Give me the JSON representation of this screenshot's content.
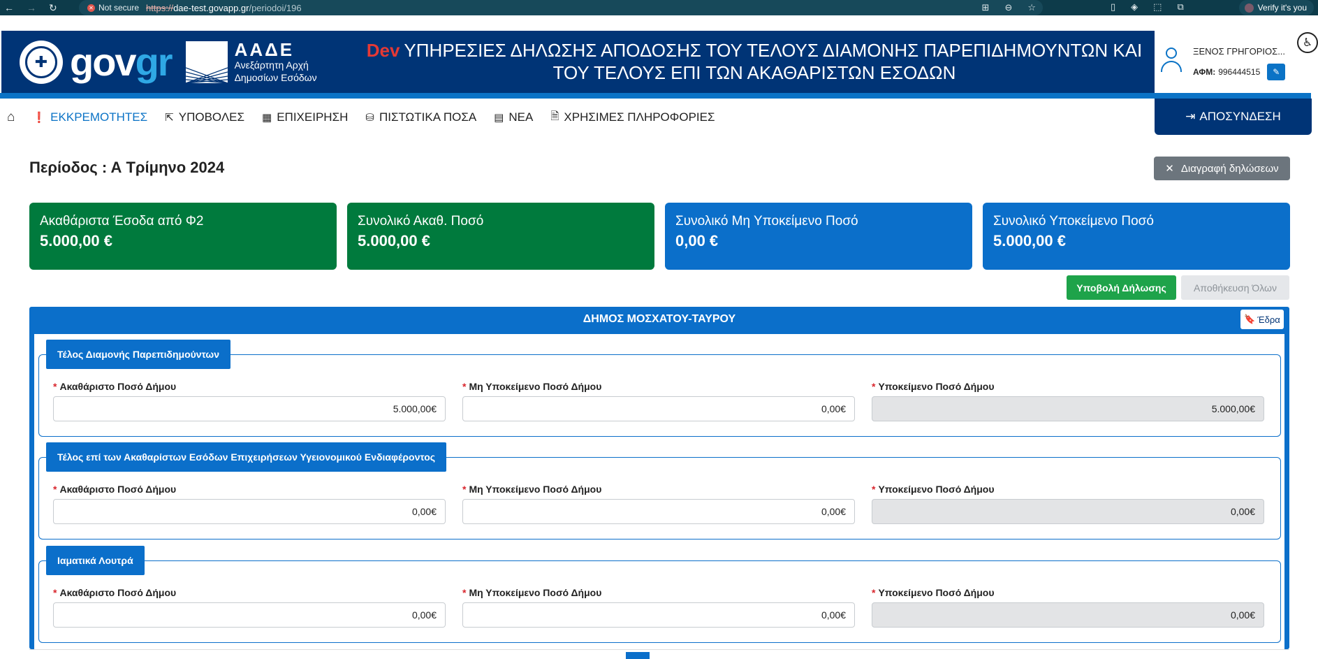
{
  "browser": {
    "security_label": "Not secure",
    "url_proto": "https://",
    "url_host": "dae-test.govapp.gr",
    "url_path": "/periodoi/196",
    "verify_label": "Verify it's you"
  },
  "header": {
    "logo_text_gov": "gov",
    "logo_text_gr": "gr",
    "aade_title": "ΑΑΔΕ",
    "aade_sub_1": "Ανεξάρτητη Αρχή",
    "aade_sub_2": "Δημοσίων Εσόδων",
    "env_label": "Dev",
    "title": "ΥΠΗΡΕΣΙΕΣ ΔΗΛΩΣΗΣ ΑΠΟΔΟΣΗΣ ΤΟΥ ΤΕΛΟΥΣ ΔΙΑΜΟΝΗΣ ΠΑΡΕΠΙΔΗΜΟΥΝΤΩΝ ΚΑΙ ΤΟΥ ΤΕΛΟΥΣ ΕΠΙ ΤΩΝ ΑΚΑΘΑΡΙΣΤΩΝ ΕΣΟΔΩΝ"
  },
  "user": {
    "name": "ΞΕΝΟΣ ΓΡΗΓΟΡΙΟΣ...",
    "afm_label": "ΑΦΜ:",
    "afm_value": "996444515"
  },
  "nav": {
    "items": [
      {
        "label": "ΕΚΚΡΕΜΟΤΗΤΕΣ"
      },
      {
        "label": "ΥΠΟΒΟΛΕΣ"
      },
      {
        "label": "ΕΠΙΧΕΙΡΗΣΗ"
      },
      {
        "label": "ΠΙΣΤΩΤΙΚΑ ΠΟΣΑ"
      },
      {
        "label": "ΝΕΑ"
      },
      {
        "label": "ΧΡΗΣΙΜΕΣ ΠΛΗΡΟΦΟΡΙΕΣ"
      }
    ],
    "logout_label": "ΑΠΟΣΥΝΔΕΣΗ"
  },
  "period": {
    "title": "Περίοδος : Α Τρίμηνο 2024",
    "delete_label": "Διαγραφή δηλώσεων"
  },
  "cards": [
    {
      "label": "Ακαθάριστα Έσοδα από Φ2",
      "value": "5.000,00 €",
      "color": "#007a3d"
    },
    {
      "label": "Συνολικό Ακαθ. Ποσό",
      "value": "5.000,00 €",
      "color": "#007a3d"
    },
    {
      "label": "Συνολικό Μη Υποκείμενο Ποσό",
      "value": "0,00 €",
      "color": "#0b6fca"
    },
    {
      "label": "Συνολικό Υποκείμενο Ποσό",
      "value": "5.000,00 €",
      "color": "#0b6fca"
    }
  ],
  "actions": {
    "submit_label": "Υποβολή Δήλωσης",
    "saveall_label": "Αποθήκευση Όλων"
  },
  "municipality": {
    "name": "ΔΗΜΟΣ ΜΟΣΧΑΤΟΥ-ΤΑΥΡΟΥ",
    "edra_label": "Έδρα",
    "sections": [
      {
        "title": "Τέλος Διαμονής Παρεπιδημούντων",
        "gross_label": "Ακαθάριστο Ποσό Δήμου",
        "gross_value": "5.000,00€",
        "nonsubject_label": "Μη Υποκείμενο Ποσό Δήμου",
        "nonsubject_value": "0,00€",
        "subject_label": "Υποκείμενο Ποσό Δήμου",
        "subject_value": "5.000,00€"
      },
      {
        "title": "Τέλος επί των Ακαθαρίστων Εσόδων Επιχειρήσεων Υγειονομικού Ενδιαφέροντος",
        "gross_label": "Ακαθάριστο Ποσό Δήμου",
        "gross_value": "0,00€",
        "nonsubject_label": "Μη Υποκείμενο Ποσό Δήμου",
        "nonsubject_value": "0,00€",
        "subject_label": "Υποκείμενο Ποσό Δήμου",
        "subject_value": "0,00€"
      },
      {
        "title": "Ιαματικά Λουτρά",
        "gross_label": "Ακαθάριστο Ποσό Δήμου",
        "gross_value": "0,00€",
        "nonsubject_label": "Μη Υποκείμενο Ποσό Δήμου",
        "nonsubject_value": "0,00€",
        "subject_label": "Υποκείμενο Ποσό Δήμου",
        "subject_value": "0,00€"
      }
    ]
  }
}
